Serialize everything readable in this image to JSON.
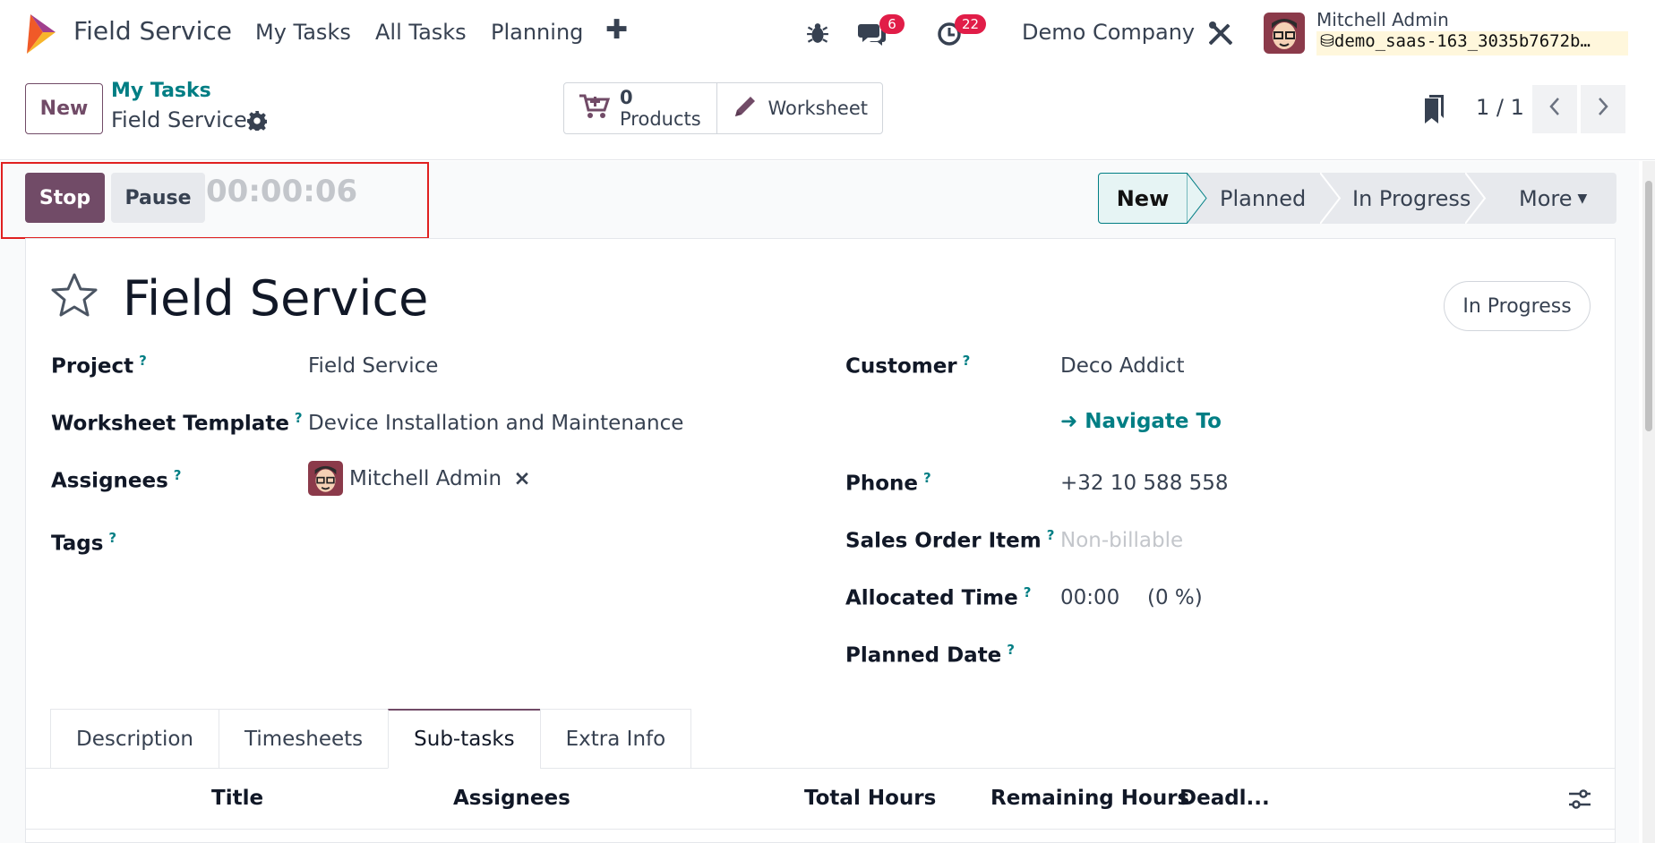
{
  "navbar": {
    "app_name": "Field Service",
    "menu": [
      "My Tasks",
      "All Tasks",
      "Planning"
    ],
    "messages_count": "6",
    "activities_count": "22",
    "company": "Demo Company",
    "user_name": "Mitchell Admin",
    "database": "demo_saas-163_3035b7672b…"
  },
  "control_panel": {
    "new_label": "New",
    "breadcrumb_parent": "My Tasks",
    "breadcrumb_current": "Field Service",
    "products_count": "0",
    "products_label": "Products",
    "worksheet_label": "Worksheet",
    "pager_value": "1 / 1"
  },
  "timer": {
    "stop_label": "Stop",
    "pause_label": "Pause",
    "elapsed": "00:00:06"
  },
  "stages": {
    "items": [
      "New",
      "Planned",
      "In Progress",
      "More"
    ],
    "active": "New"
  },
  "task": {
    "title": "Field Service",
    "state": "In Progress"
  },
  "fields": {
    "project_label": "Project",
    "project_value": "Field Service",
    "worksheet_label": "Worksheet Template",
    "worksheet_value": "Device Installation and Maintenance",
    "assignees_label": "Assignees",
    "assignee_name": "Mitchell Admin",
    "tags_label": "Tags",
    "customer_label": "Customer",
    "customer_value": "Deco Addict",
    "navigate_label": "Navigate To",
    "phone_label": "Phone",
    "phone_value": "+32 10 588 558",
    "so_item_label": "Sales Order Item",
    "so_item_placeholder": "Non-billable",
    "allocated_label": "Allocated Time",
    "allocated_value": "00:00",
    "allocated_percent": "(0 %)",
    "planned_label": "Planned Date",
    "help_mark": "?"
  },
  "tabs": [
    "Description",
    "Timesheets",
    "Sub-tasks",
    "Extra Info"
  ],
  "active_tab": "Sub-tasks",
  "subtasks_table": {
    "columns": [
      "Title",
      "Assignees",
      "Total Hours",
      "Remaining Hours",
      "Deadl..."
    ]
  },
  "colors": {
    "brand": "#714b67",
    "link": "#017e84",
    "badge": "#e11d48",
    "highlight": "#e02020"
  }
}
